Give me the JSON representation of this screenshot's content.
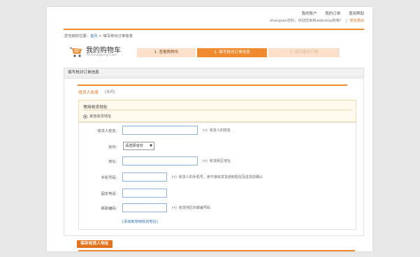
{
  "header": {
    "links": [
      "我的账户",
      "我的订单",
      "使用帮助"
    ],
    "welcome": "zhangsan您好，欢迎您来到webshop购物！",
    "safe_exit": "安全退出"
  },
  "breadcrumb": {
    "prefix": "您当前的位置：",
    "home": "首页",
    "sep": " > ",
    "current": "填写核对订单信息"
  },
  "cart": {
    "title": "我的购物车",
    "subtitle": "MyShopping Cart"
  },
  "steps": [
    {
      "label": "1. 查看购物车"
    },
    {
      "label": "2. 填写核对订单信息"
    },
    {
      "label": "3. 成功提交订单"
    }
  ],
  "section": {
    "title": "填写核对订单信息"
  },
  "receiver": {
    "title": "收货人信息",
    "close": "[关闭]",
    "common_title": "常用收货地址",
    "new_address": "其他收货地址"
  },
  "form": {
    "name_label": "收货人姓名：",
    "name_hint": "收货人的姓名",
    "province_label": "省份：",
    "province_value": "请选择省份",
    "address_label": "地址：",
    "address_hint": "收货街区地址",
    "mobile_label": "手机号码：",
    "mobile_hint": "收货人的手机号，用于接收发货通知短信及送货前确认",
    "phone_label": "固定电话：",
    "zip_label": "邮政编码：",
    "zip_hint": "收货地区的邮编号码",
    "hint_marker": "(•)",
    "add_link": "[添加到常用收货地址]"
  },
  "save_button": "保存收货人地址",
  "colors": {
    "accent": "#f08a30",
    "link": "#2f6fb2"
  }
}
